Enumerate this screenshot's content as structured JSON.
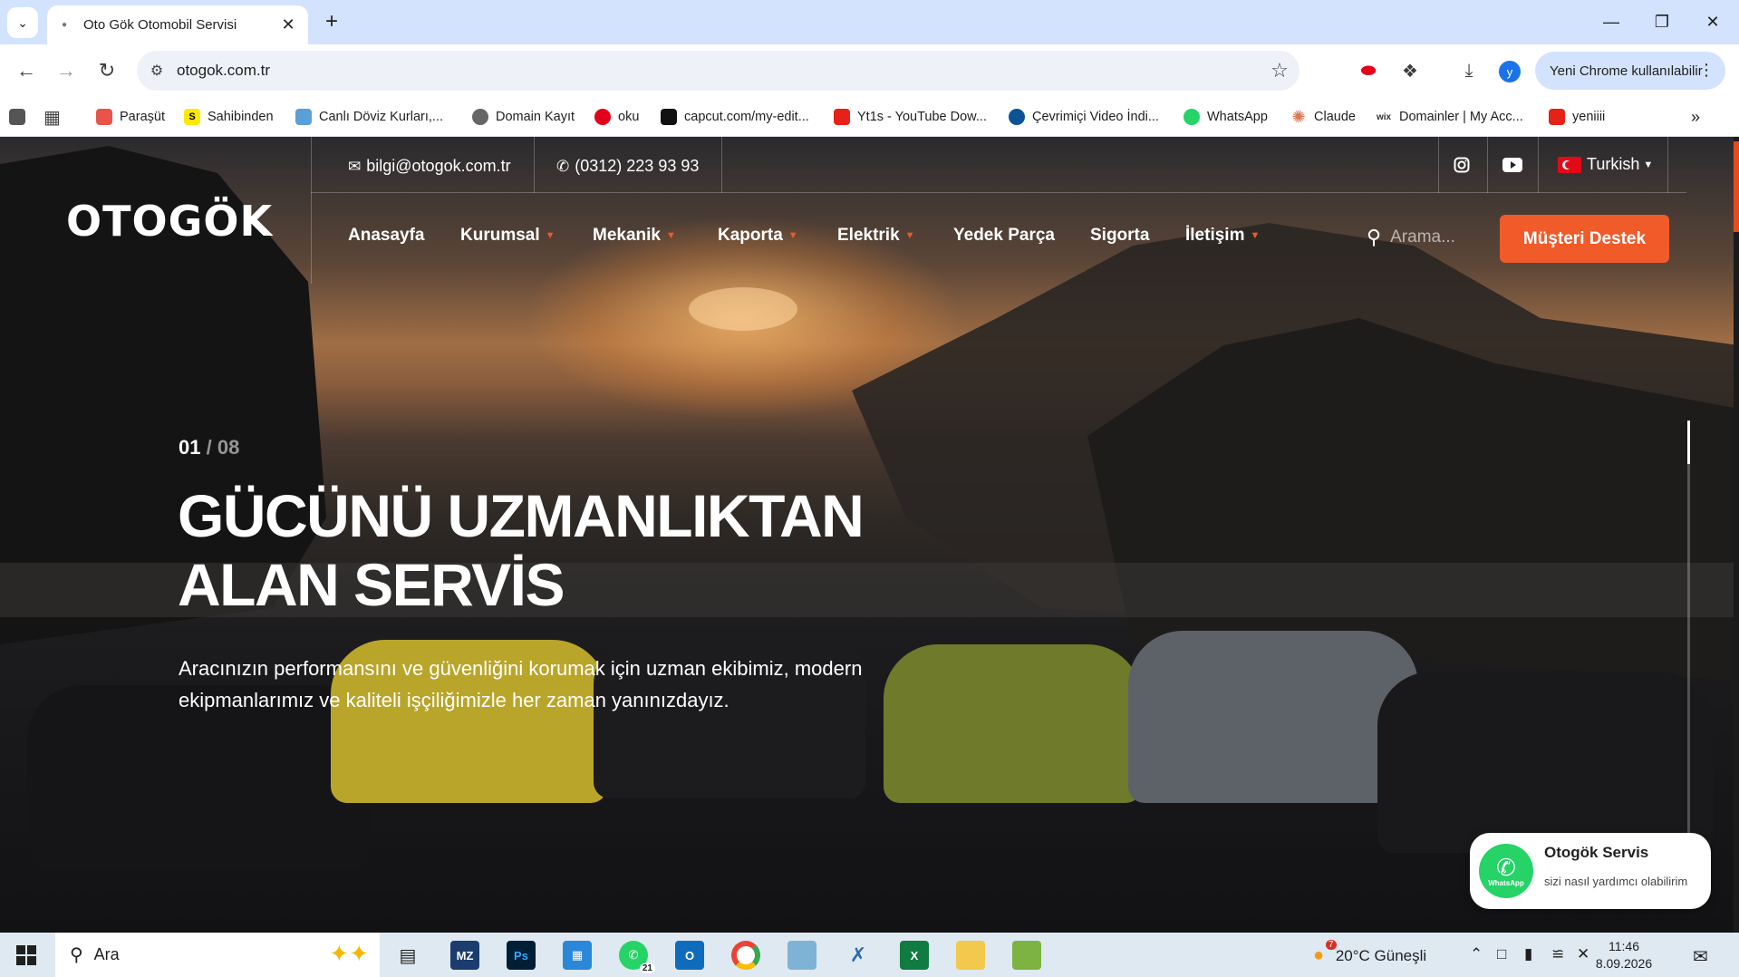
{
  "browser": {
    "tab_title": "Oto Gök Otomobil Servisi",
    "url": "otogok.com.tr",
    "profile_initial": "y",
    "update_label": "Yeni Chrome kullanılabilir",
    "bookmarks": [
      {
        "label": "Paraşüt",
        "color": "#e8534a"
      },
      {
        "label": "Sahibinden",
        "color": "#ffe800"
      },
      {
        "label": "Canlı Döviz Kurları,...",
        "color": "#5aa0d8"
      },
      {
        "label": "Domain Kayıt",
        "color": "#666666"
      },
      {
        "label": "oku",
        "color": "#e2001a"
      },
      {
        "label": "capcut.com/my-edit...",
        "color": "#111111"
      },
      {
        "label": "Yt1s - YouTube Dow...",
        "color": "#e62117"
      },
      {
        "label": "Çevrimiçi Video İndi...",
        "color": "#0b5394"
      },
      {
        "label": "WhatsApp",
        "color": "#25d366"
      },
      {
        "label": "Claude",
        "color": "#d97757"
      },
      {
        "label": "Domainler | My Acc...",
        "color": "#333333"
      },
      {
        "label": "yeniiii",
        "color": "#e62117"
      }
    ]
  },
  "site": {
    "email": "bilgi@otogok.com.tr",
    "phone": "(0312) 223 93 93",
    "language": "Turkish",
    "logo": "OTOGÖK",
    "nav": [
      {
        "label": "Anasayfa",
        "has_caret": false
      },
      {
        "label": "Kurumsal",
        "has_caret": true
      },
      {
        "label": "Mekanik",
        "has_caret": true
      },
      {
        "label": "Kaporta",
        "has_caret": true
      },
      {
        "label": "Elektrik",
        "has_caret": true
      },
      {
        "label": "Yedek Parça",
        "has_caret": false
      },
      {
        "label": "Sigorta",
        "has_caret": false
      },
      {
        "label": "İletişim",
        "has_caret": true
      }
    ],
    "search_placeholder": "Arama...",
    "cta": "Müşteri Destek",
    "slide_current": "01",
    "slide_total": "/ 08",
    "hero_title_line1": "GÜCÜNÜ UZMANLIKTAN",
    "hero_title_line2": "ALAN SERVİS",
    "hero_text": "Aracınızın performansını ve güvenliğini korumak için uzman ekibimiz, modern ekipmanlarımız ve kaliteli işçiliğimizle her zaman yanınızdayız.",
    "whatsapp": {
      "name": "Otogök Servis",
      "message": "sizi nasıl yardımcı olabilirim",
      "icon_label": "WhatsApp"
    },
    "accent": "#f15a29"
  },
  "taskbar": {
    "search_label": "Ara",
    "whatsapp_badge": "21",
    "weather": "20°C  Güneşli",
    "weather_badge": "7",
    "time": "11:46",
    "date": "8.09.2026"
  }
}
